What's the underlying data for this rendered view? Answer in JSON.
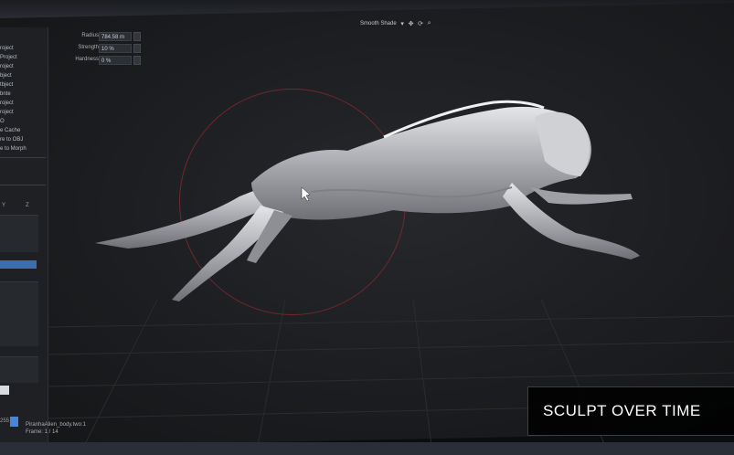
{
  "left_panel": {
    "menu_items": [
      "roject",
      "Project",
      "roject",
      "bject",
      "tbject",
      "bnte",
      "roject",
      "roject",
      "O",
      "e Cache",
      "re to OBJ",
      "e to Morph"
    ],
    "axis_y": "Y",
    "axis_z": "Z",
    "value_label": "255"
  },
  "brush": {
    "radius_label": "Radius",
    "radius_value": "784.58 m",
    "strength_label": "Strength",
    "strength_value": "10 %",
    "hardness_label": "Hardness",
    "hardness_value": "0 %"
  },
  "toolbar": {
    "shading_mode": "Smooth Shade",
    "icons": [
      "dropdown-arrow-icon",
      "move-icon",
      "rotate-icon",
      "zoom-icon"
    ]
  },
  "viewport": {
    "mesh_name": "PiranhaAlien_body.two:1",
    "frame": "Frame: 1 / 14"
  },
  "caption": {
    "text": "SCULPT OVER TIME"
  },
  "colors": {
    "accent_blue": "#4a86d8",
    "brush_ring": "#8a2a33",
    "mesh": "#c8c9cc"
  }
}
